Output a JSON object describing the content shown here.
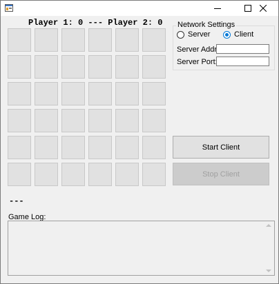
{
  "titlebar": {
    "minimize_icon": "minimize-icon",
    "maximize_icon": "maximize-icon",
    "close_icon": "close-icon"
  },
  "score_text": "Player 1: 0 --- Player 2: 0",
  "grid": {
    "rows": 6,
    "cols": 6
  },
  "status_text": "---",
  "network": {
    "title": "Network Settings",
    "options": [
      {
        "label": "Server",
        "checked": false
      },
      {
        "label": "Client",
        "checked": true
      }
    ],
    "address_label": "Server Address:",
    "address_value": "",
    "port_label": "Server Port:",
    "port_value": ""
  },
  "buttons": {
    "start_label": "Start Client",
    "stop_label": "Stop Client",
    "stop_enabled": false
  },
  "log": {
    "label": "Game Log:",
    "text": ""
  },
  "colors": {
    "accent": "#0078d7",
    "window_bg": "#f0f0f0",
    "cell_bg": "#e1e1e1"
  }
}
